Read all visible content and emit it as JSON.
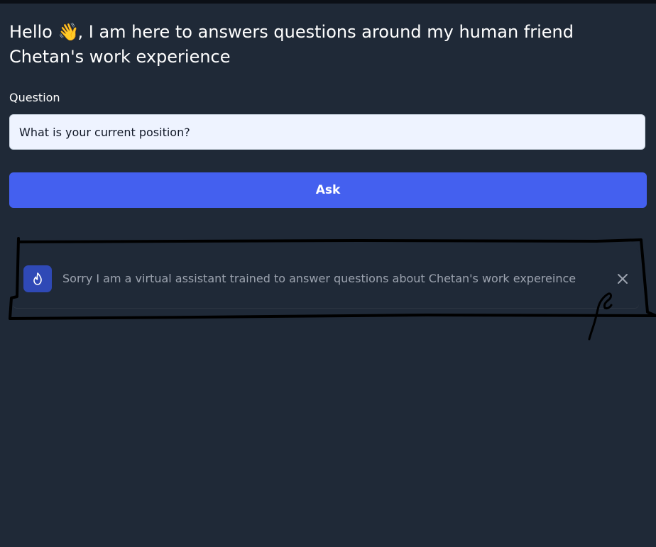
{
  "heading": {
    "hello": "Hello",
    "wave_emoji": "👋",
    "rest": ", I am here to answers questions around my human friend Chetan's work experience"
  },
  "form": {
    "question_label": "Question",
    "question_value": "What is your current position?",
    "ask_label": "Ask"
  },
  "toast": {
    "message": "Sorry I am a virtual assistant trained to answer questions about Chetan's work expereince",
    "icon": "fire-icon",
    "close_icon": "close-icon"
  },
  "colors": {
    "background": "#1f2937",
    "accent": "#4460ef",
    "toast_icon_bg": "#2f49b6"
  }
}
